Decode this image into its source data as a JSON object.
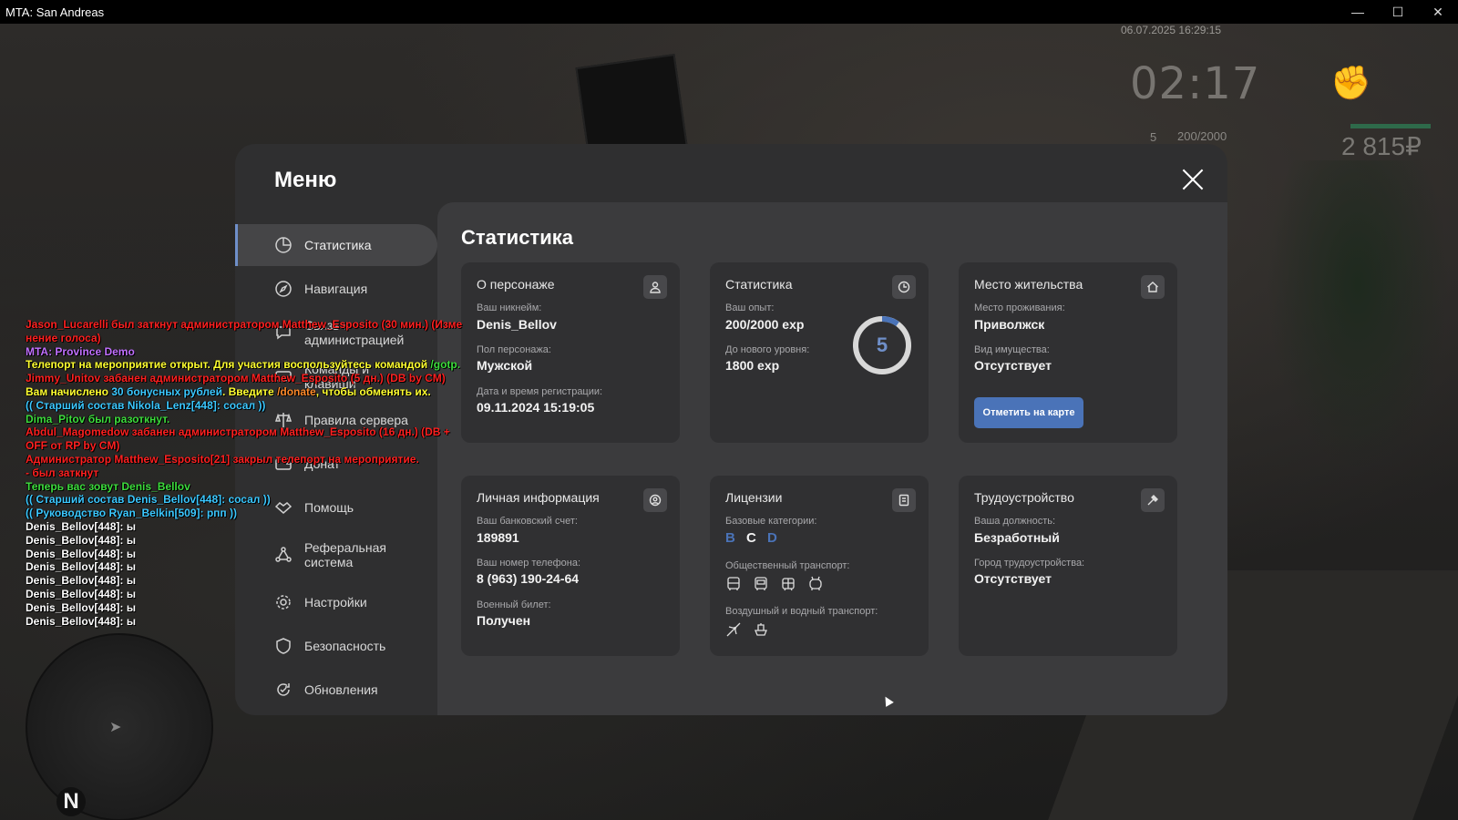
{
  "window": {
    "title": "MTA: San Andreas",
    "minimize": "—",
    "maximize": "☐",
    "close": "✕"
  },
  "hud": {
    "datetime": "06.07.2025 16:29:15",
    "time": "02:17",
    "level": "5",
    "exp": "200/2000",
    "money": "2 815₽"
  },
  "radar": {
    "north": "N"
  },
  "menu": {
    "title": "Меню",
    "sidebar": [
      {
        "label": "Статистика",
        "icon": "stats-icon"
      },
      {
        "label": "Навигация",
        "icon": "compass-icon"
      },
      {
        "label": "Связь с администрацией",
        "icon": "chat-icon"
      },
      {
        "label": "Команды и клавиши",
        "icon": "keyboard-icon"
      },
      {
        "label": "Правила сервера",
        "icon": "scales-icon"
      },
      {
        "label": "Донат",
        "icon": "wallet-icon"
      },
      {
        "label": "Помощь",
        "icon": "handshake-icon"
      },
      {
        "label": "Реферальная система",
        "icon": "network-icon"
      },
      {
        "label": "Настройки",
        "icon": "gear-icon"
      },
      {
        "label": "Безопасность",
        "icon": "shield-icon"
      },
      {
        "label": "Обновления",
        "icon": "update-icon"
      }
    ],
    "active_index": 0
  },
  "content": {
    "title": "Статистика",
    "character": {
      "heading": "О персонаже",
      "nickname_label": "Ваш никнейм:",
      "nickname": "Denis_Bellov",
      "gender_label": "Пол персонажа:",
      "gender": "Мужской",
      "reg_label": "Дата и время регистрации:",
      "reg": "09.11.2024 15:19:05"
    },
    "stats": {
      "heading": "Статистика",
      "exp_label": "Ваш опыт:",
      "exp": "200/2000 exp",
      "next_label": "До нового уровня:",
      "next": "1800 exp",
      "level": "5",
      "progress": 0.1
    },
    "residence": {
      "heading": "Место жительства",
      "place_label": "Место проживания:",
      "place": "Приволжск",
      "property_label": "Вид имущества:",
      "property": "Отсутствует",
      "map_button": "Отметить на карте"
    },
    "personal": {
      "heading": "Личная информация",
      "bank_label": "Ваш банковский счет:",
      "bank": "189891",
      "phone_label": "Ваш номер телефона:",
      "phone": "8 (963) 190-24-64",
      "military_label": "Военный билет:",
      "military": "Получен"
    },
    "licenses": {
      "heading": "Лицензии",
      "base_label": "Базовые категории:",
      "cat_b": "B",
      "cat_c": "C",
      "cat_d": "D",
      "public_label": "Общественный транспорт:",
      "air_label": "Воздушный и водный транспорт:"
    },
    "employment": {
      "heading": "Трудоустройство",
      "position_label": "Ваша должность:",
      "position": "Безработный",
      "city_label": "Город трудоустройства:",
      "city": "Отсутствует"
    }
  },
  "colors": {
    "accent": "#4a73b8",
    "active_border": "#6f8fc9",
    "modal_bg": "#2f2f30",
    "content_bg": "#3b3b3d",
    "card_bg": "#303032"
  },
  "chat": [
    {
      "parts": [
        {
          "t": "Jason_Lucarelli был заткнут администратором Matthew_Esposito (30 мин.) (Изме",
          "c": "red"
        }
      ]
    },
    {
      "parts": [
        {
          "t": "нение голоса)",
          "c": "red"
        }
      ]
    },
    {
      "parts": [
        {
          "t": "MTA: Province Demo",
          "c": "purple"
        }
      ]
    },
    {
      "parts": [
        {
          "t": "Телепорт на мероприятие открыт. Для участия воспользуйтесь командой ",
          "c": "yellow"
        },
        {
          "t": "/gotp.",
          "c": "green"
        }
      ]
    },
    {
      "parts": [
        {
          "t": "Jimmy_Unitov забанен администратором Matthew_Esposito (5 дн.) (DB by CM)",
          "c": "red"
        }
      ]
    },
    {
      "parts": [
        {
          "t": "Вам начислено ",
          "c": "yellow"
        },
        {
          "t": "30 бонусных рублей",
          "c": "cyan"
        },
        {
          "t": ". Введите ",
          "c": "yellow"
        },
        {
          "t": "/donate",
          "c": "orange"
        },
        {
          "t": ", чтобы обменять их.",
          "c": "yellow"
        }
      ]
    },
    {
      "parts": [
        {
          "t": "(( Старший состав Nikola_Lenz[448]: сосал ))",
          "c": "cyan"
        }
      ]
    },
    {
      "parts": [
        {
          "t": "Dima_Pitov был разоткнут.",
          "c": "green"
        }
      ]
    },
    {
      "parts": [
        {
          "t": "Abdul_Magomedow забанен администратором Matthew_Esposito (16 дн.) (DB +",
          "c": "red"
        }
      ]
    },
    {
      "parts": [
        {
          "t": " OFF от RP by CM)",
          "c": "red"
        }
      ]
    },
    {
      "parts": [
        {
          "t": "Администратор Matthew_Esposito[21] закрыл телепорт на мероприятие.",
          "c": "red"
        }
      ]
    },
    {
      "parts": [
        {
          "t": " - был заткнут",
          "c": "red"
        }
      ]
    },
    {
      "parts": [
        {
          "t": "Теперь вас зовут Denis_Bellov",
          "c": "green"
        }
      ]
    },
    {
      "parts": [
        {
          "t": "(( Старший состав Denis_Bellov[448]: сосал ))",
          "c": "cyan"
        }
      ]
    },
    {
      "parts": [
        {
          "t": "(( Руководство Ryan_Belkin[509]: рпп ))",
          "c": "cyan"
        }
      ]
    },
    {
      "parts": [
        {
          "t": "Denis_Bellov[448]: ы",
          "c": "white"
        }
      ]
    },
    {
      "parts": [
        {
          "t": "Denis_Bellov[448]: ы",
          "c": "white"
        }
      ]
    },
    {
      "parts": [
        {
          "t": "Denis_Bellov[448]: ы",
          "c": "white"
        }
      ]
    },
    {
      "parts": [
        {
          "t": "Denis_Bellov[448]: ы",
          "c": "white"
        }
      ]
    },
    {
      "parts": [
        {
          "t": "Denis_Bellov[448]: ы",
          "c": "white"
        }
      ]
    },
    {
      "parts": [
        {
          "t": "Denis_Bellov[448]: ы",
          "c": "white"
        }
      ]
    },
    {
      "parts": [
        {
          "t": "Denis_Bellov[448]: ы",
          "c": "white"
        }
      ]
    },
    {
      "parts": [
        {
          "t": "Denis_Bellov[448]: ы",
          "c": "white"
        }
      ]
    }
  ]
}
